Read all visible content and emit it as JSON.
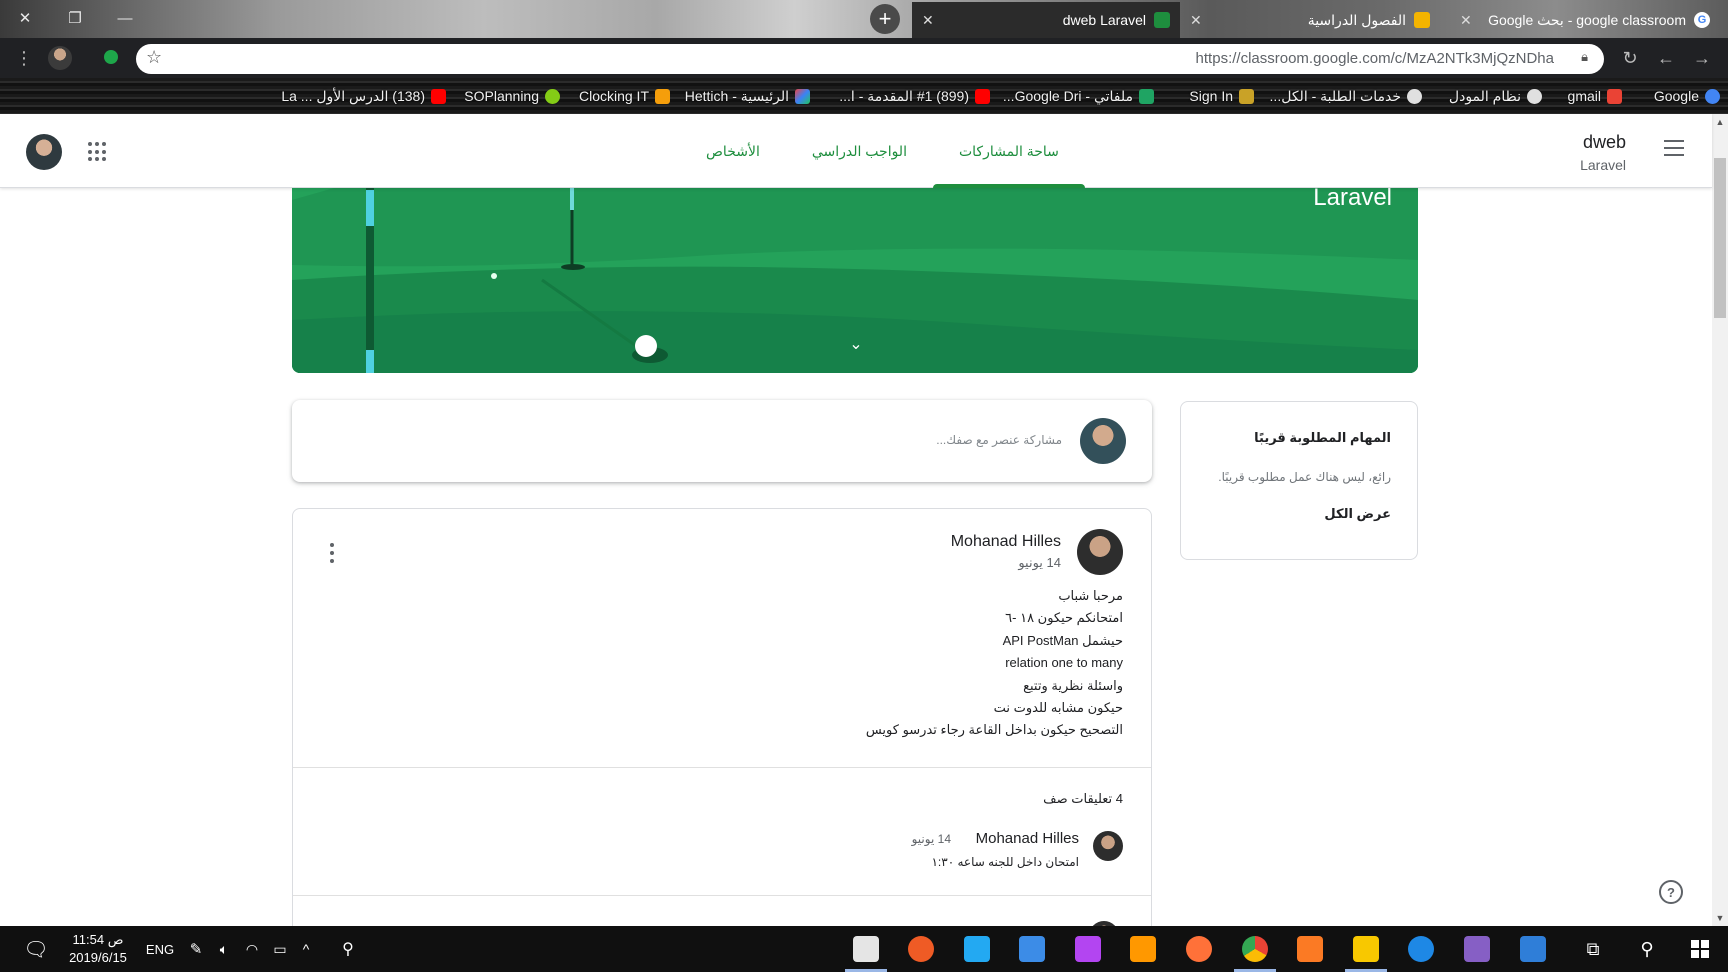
{
  "browser": {
    "tabs": [
      {
        "title": "dweb Laravel",
        "active": true
      },
      {
        "title": "الفصول الدراسية",
        "active": false
      },
      {
        "title": "google classroom - بحث Google",
        "active": false
      }
    ],
    "url": "https://classroom.google.com/c/MzA2NTk3MjQzNDha",
    "bookmarks": [
      {
        "label": "Google",
        "icon": "google-icon",
        "color": "#4285f4"
      },
      {
        "label": "gmail",
        "icon": "gmail-icon",
        "color": "#ea4335"
      },
      {
        "label": "نظام المودل",
        "icon": "globe-icon",
        "color": "#e0e0e0"
      },
      {
        "label": "خدمات الطلبة - الكل...",
        "icon": "globe-icon",
        "color": "#e0e0e0"
      },
      {
        "label": "Sign In",
        "icon": "trophy-icon",
        "color": "#c9a227"
      },
      {
        "label": "ملفاتي - Google Dri...",
        "icon": "drive-icon",
        "color": "#1fa463"
      },
      {
        "label": "(899) #1 المقدمة - ا...",
        "icon": "youtube-icon",
        "color": "#ff0000"
      },
      {
        "label": "الرئيسية - Hettich",
        "icon": "hettich-icon",
        "color": "#3b82f6"
      },
      {
        "label": "Clocking IT",
        "icon": "clock-icon",
        "color": "#f59e0b"
      },
      {
        "label": "SOPlanning",
        "icon": "soplanning-icon",
        "color": "#84cc16"
      },
      {
        "label": "(138) الدرس الأول ... La",
        "icon": "youtube-icon",
        "color": "#ff0000"
      }
    ]
  },
  "classroom": {
    "class_name": "dweb",
    "class_section": "Laravel",
    "tabs": [
      {
        "label": "ساحة المشاركات",
        "active": true
      },
      {
        "label": "الواجب الدراسي",
        "active": false
      },
      {
        "label": "الأشخاص",
        "active": false
      }
    ],
    "banner": {
      "title": "Laravel",
      "theme_color": "#24a25a"
    },
    "upcoming": {
      "title": "المهام المطلوبة قريبًا",
      "empty_text": "رائع، ليس هناك عمل مطلوب قريبًا.",
      "view_all": "عرض الكل"
    },
    "share": {
      "placeholder": "مشاركة عنصر مع صفك..."
    },
    "post": {
      "author": "Mohanad Hilles",
      "date": "14 يونيو",
      "body_lines": [
        "مرحبا شباب",
        "امتحانكم حيكون ١٨ -٦",
        "حيشمل API PostMan",
        "relation one to many",
        "واسئلة نظرية وتتبع",
        "حيكون مشابه للدوت نت",
        "التصحيح حيكون بداخل القاعة رجاء تدرسو كويس"
      ],
      "comments_count": "4 تعليقات صف",
      "comment": {
        "author": "Mohanad Hilles",
        "date": "14 يونيو",
        "text": "امتحان داخل للجنه ساعه ١:٣٠"
      }
    }
  },
  "taskbar": {
    "time": "11:54 ص",
    "date": "2019/6/15",
    "language": "ENG",
    "apps": [
      {
        "name": "video-editor-icon",
        "color": "#e5e5e5",
        "running": true
      },
      {
        "name": "postman-icon",
        "color": "#ef5b25",
        "running": false
      },
      {
        "name": "vscode-icon",
        "color": "#23a9f2",
        "running": false
      },
      {
        "name": "bracket-app-icon",
        "color": "#3c8ce7",
        "running": false
      },
      {
        "name": "phpstorm-icon",
        "color": "#b345f1",
        "running": false
      },
      {
        "name": "sublime-icon",
        "color": "#ff9800",
        "running": false
      },
      {
        "name": "firefox-icon",
        "color": "#ff7139",
        "running": false
      },
      {
        "name": "chrome-icon",
        "color": "#34a853",
        "running": true
      },
      {
        "name": "xampp-icon",
        "color": "#fb7a24",
        "running": false
      },
      {
        "name": "file-explorer-icon",
        "color": "#f8c800",
        "running": true
      },
      {
        "name": "edge-icon",
        "color": "#1e88e5",
        "running": false
      },
      {
        "name": "visual-studio-icon",
        "color": "#865fc5",
        "running": false
      },
      {
        "name": "remote-desktop-icon",
        "color": "#2f7ed8",
        "running": false
      }
    ]
  }
}
